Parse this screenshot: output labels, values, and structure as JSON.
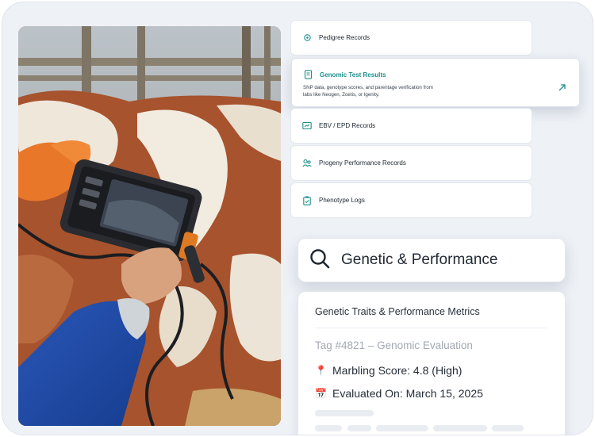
{
  "records": [
    {
      "label": "Pedigree Records",
      "icon": "pedigree-icon"
    },
    {
      "label": "Genomic Test Results",
      "icon": "genomic-doc-icon",
      "active": true,
      "description": "SNP data, genotype scores, and parentage verification from labs like Neogen, Zoetis, or Igenity."
    },
    {
      "label": "EBV / EPD Records",
      "icon": "ebv-chart-icon"
    },
    {
      "label": "Progeny Performance Records",
      "icon": "progeny-icon"
    },
    {
      "label": "Phenotype Logs",
      "icon": "clipboard-icon"
    }
  ],
  "search": {
    "text": "Genetic & Performance",
    "icon": "search-icon"
  },
  "card": {
    "title": "Genetic Traits & Performance Metrics",
    "tag": "Tag #4821 – Genomic Evaluation",
    "marbling": "Marbling Score: 4.8 (High)",
    "evaluated": "Evaluated On: March 15, 2025",
    "marbling_icon": "📍",
    "evaluated_icon": "📅"
  },
  "colors": {
    "accent": "#1c8f8c",
    "background": "#eef1f6"
  }
}
